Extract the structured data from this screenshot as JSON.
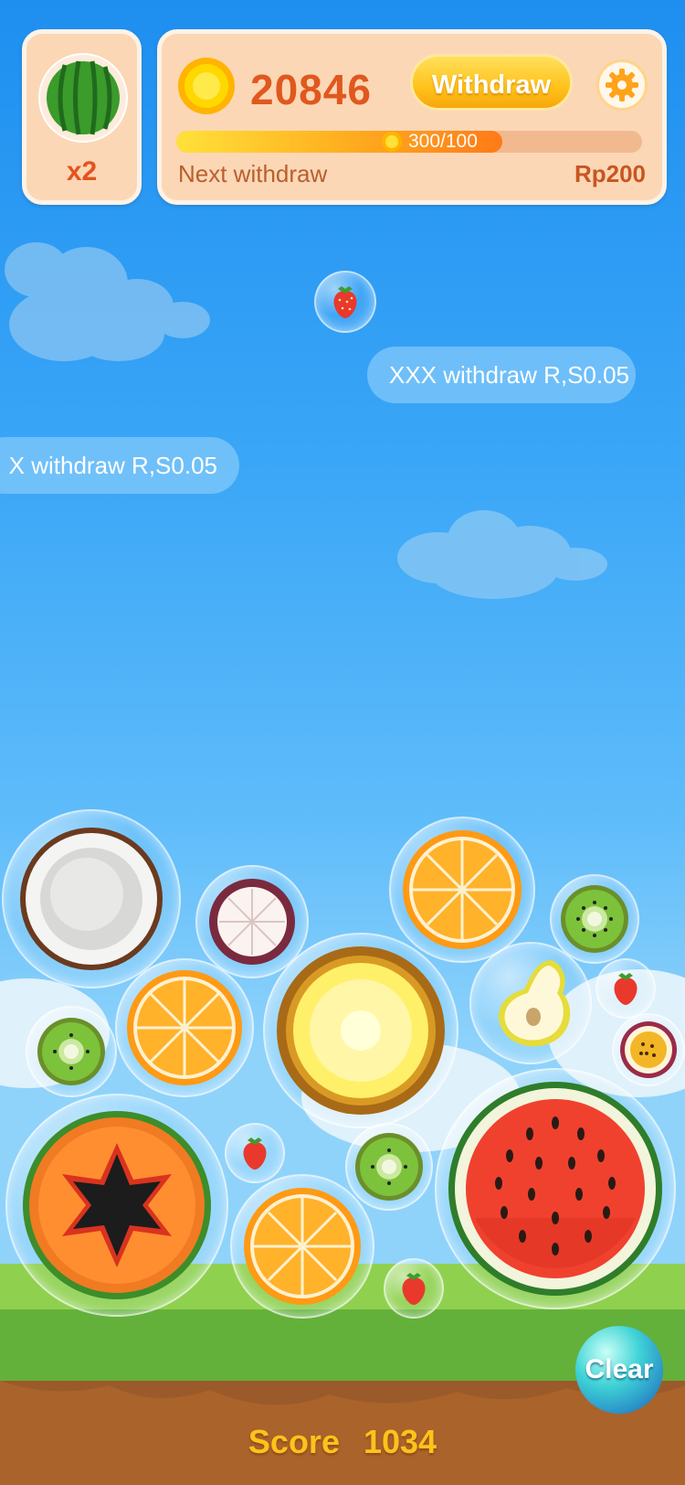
{
  "header": {
    "multiplier_label": "x2",
    "coins": "20846",
    "withdraw_label": "Withdraw",
    "progress_text": "300/100",
    "progress_fraction": 0.7,
    "next_withdraw_label": "Next withdraw",
    "next_withdraw_amount": "Rp200"
  },
  "messages": [
    {
      "text": "XXX withdraw R,S0.05"
    },
    {
      "text": "X withdraw R,S0.05"
    }
  ],
  "controls": {
    "clear_label": "Clear"
  },
  "score": {
    "label": "Score",
    "value": "1034"
  },
  "colors": {
    "coin_text": "#e0581e",
    "card_bg": "#fbd7b6",
    "withdraw_btn": "#ffc21a",
    "score": "#ffc21a"
  },
  "icons": [
    "watermelon-icon",
    "coin-icon",
    "gear-icon",
    "strawberry-icon",
    "coconut-icon",
    "mangosteen-icon",
    "orange-icon",
    "kiwi-icon",
    "pear-icon",
    "pineapple-icon",
    "passionfruit-icon",
    "papaya-icon"
  ]
}
